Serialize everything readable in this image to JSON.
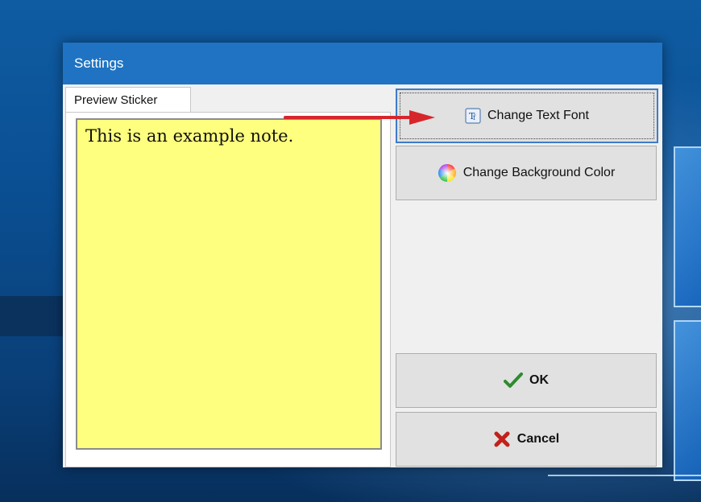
{
  "window": {
    "title": "Settings"
  },
  "tabs": [
    {
      "label": "Preview Sticker"
    }
  ],
  "note": {
    "text": "This is an example note.",
    "background": "#ffff7f"
  },
  "buttons": {
    "change_font": {
      "label": "Change Text Font",
      "icon": "font-icon"
    },
    "change_bg": {
      "label": "Change Background Color",
      "icon": "color-wheel-icon"
    },
    "ok": {
      "label": "OK",
      "icon": "checkmark-icon"
    },
    "cancel": {
      "label": "Cancel",
      "icon": "x-icon"
    }
  },
  "colors": {
    "titlebar": "#1f73c2",
    "arrow": "#d7262b",
    "ok_check": "#2e8b2e",
    "cancel_x": "#c0221b"
  }
}
